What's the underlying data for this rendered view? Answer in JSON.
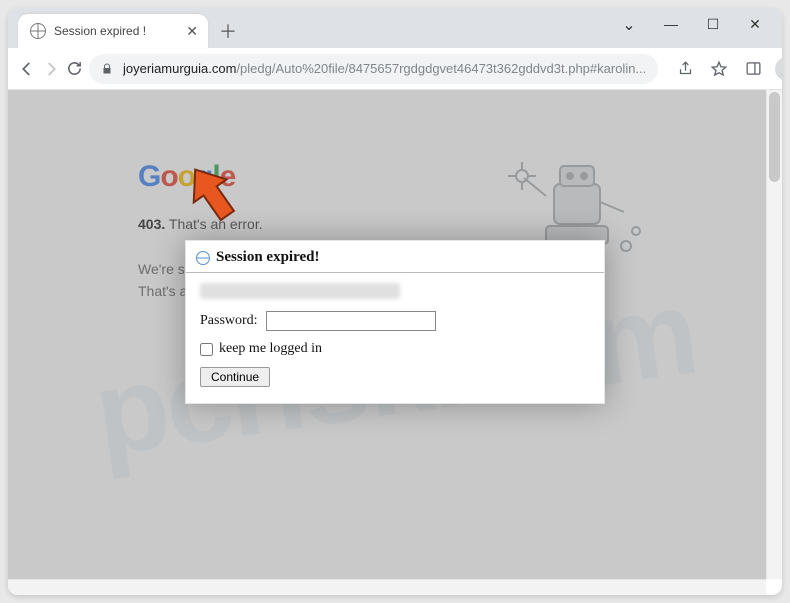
{
  "tab": {
    "title": "Session expired !"
  },
  "url": {
    "host": "joyeriamurguia.com",
    "path": "/pledg/Auto%20file/8475657rgdgdgvet46473t362gddvd3t.php#karolin..."
  },
  "page": {
    "logo": "Google",
    "error_bold": "403.",
    "error_rest": " That's an error.",
    "line1": "We're sorry, but you",
    "line2": "That's all we know"
  },
  "modal": {
    "title": "Session expired!",
    "password_label": "Password:",
    "password_value": "",
    "keep_label": "keep me logged in",
    "continue_label": "Continue"
  },
  "watermark": "pcrisk.com"
}
